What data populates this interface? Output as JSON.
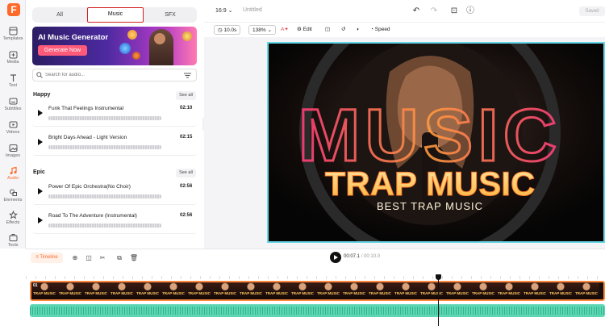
{
  "app": {
    "logo": "F"
  },
  "rail": {
    "items": [
      {
        "label": "Templates",
        "icon": "templates-icon"
      },
      {
        "label": "Media",
        "icon": "media-icon"
      },
      {
        "label": "Text",
        "icon": "text-icon"
      },
      {
        "label": "Subtitles",
        "icon": "subtitles-icon"
      },
      {
        "label": "Videos",
        "icon": "videos-icon"
      },
      {
        "label": "Images",
        "icon": "images-icon"
      },
      {
        "label": "Audio",
        "icon": "audio-icon"
      },
      {
        "label": "Elements",
        "icon": "elements-icon"
      },
      {
        "label": "Effects",
        "icon": "effects-icon"
      },
      {
        "label": "Tools",
        "icon": "tools-icon"
      }
    ],
    "active": "Audio"
  },
  "library": {
    "tabs": [
      "All",
      "Music",
      "SFX"
    ],
    "active_tab": "Music",
    "banner": {
      "title": "AI Music Generator",
      "button": "Generate Now"
    },
    "search": {
      "placeholder": "Search for audio..."
    },
    "sections": [
      {
        "title": "Happy",
        "see_all": "See all",
        "tracks": [
          {
            "name": "Funk That Feelings Instrumental",
            "duration": "02:10"
          },
          {
            "name": "Bright Days Ahead - Light Version",
            "duration": "02:15"
          }
        ]
      },
      {
        "title": "Epic",
        "see_all": "See all",
        "tracks": [
          {
            "name": "Power Of Epic Orchestra(No Choir)",
            "duration": "02:56"
          },
          {
            "name": "Road To The Adventure (Instrumental)",
            "duration": "02:56"
          }
        ]
      }
    ]
  },
  "topbar": {
    "ratio": "16:9",
    "title": "Untitled",
    "saved": "Saved"
  },
  "toolbar": {
    "duration": "10.0s",
    "zoom": "138%",
    "edit": "Edit",
    "speed": "Speed"
  },
  "preview": {
    "headline": "TRAP MUSIC",
    "subline": "BEST TRAP MUSIC",
    "bg_word": "MUSIC"
  },
  "timeline": {
    "tab": "Timeline",
    "current_time": "00:07.1",
    "total_time": "/ 00:10.0",
    "clip_number": "01",
    "thumb_text": "TRAP MUSIC",
    "playhead_fraction": 0.71
  },
  "colors": {
    "accent": "#ff6a2b",
    "selection": "#67d6e6",
    "audio_track": "#5ed6b3",
    "tab_outline": "#d32020"
  }
}
